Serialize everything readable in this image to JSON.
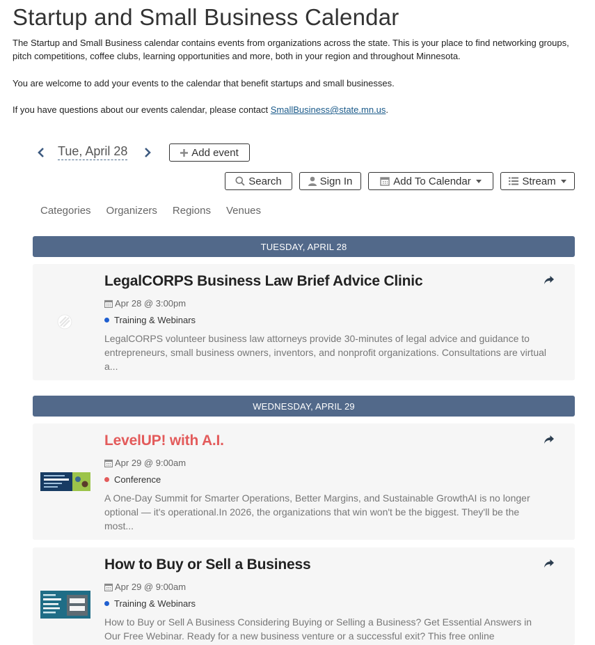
{
  "page": {
    "title": "Startup and Small Business Calendar",
    "intro_1": "The Startup and Small Business calendar contains events from organizations across the state. This is your place to find networking groups, pitch competitions, coffee clubs, learning opportunities and more, both in your region and throughout Minnesota.",
    "intro_2": "You are welcome to add your events to the calendar that benefit startups and small businesses.",
    "intro_3_prefix": "If you have questions about our events calendar, please contact ",
    "intro_3_link": "SmallBusiness@state.mn.us",
    "intro_3_suffix": "."
  },
  "toolbar": {
    "current_date": "Tue, April 28",
    "add_event_label": "Add event",
    "search_label": "Search",
    "sign_in_label": "Sign In",
    "add_to_calendar_label": "Add To Calendar",
    "stream_label": "Stream"
  },
  "filters": [
    "Categories",
    "Organizers",
    "Regions",
    "Venues"
  ],
  "days": [
    {
      "header": "TUESDAY, APRIL 28",
      "events": [
        {
          "title": "LegalCORPS Business Law Brief Advice Clinic",
          "date": "Apr 28 @ 3:00pm",
          "category": "Training & Webinars",
          "category_color": "#1f5fd0",
          "title_color": "#1f5fd0",
          "description": "LegalCORPS volunteer business law attorneys provide 30-minutes of legal advice and guidance to entrepreneurs, small business owners, inventors, and nonprofit organizations. Consultations are virtual a..."
        }
      ]
    },
    {
      "header": "WEDNESDAY, APRIL 29",
      "events": [
        {
          "title": "LevelUP! with A.I.",
          "date": "Apr 29 @ 9:00am",
          "category": "Conference",
          "category_color": "#e35b5b",
          "title_color": "#e35b5b",
          "description": "A One-Day Summit for Smarter Operations, Better Margins, and Sustainable GrowthAI is no longer optional — it's operational.In 2026, the organizations that win won't be the biggest. They'll be the most..."
        },
        {
          "title": "How to Buy or Sell a Business",
          "date": "Apr 29 @ 9:00am",
          "category": "Training & Webinars",
          "category_color": "#1f5fd0",
          "title_color": "#1f5fd0",
          "description": "How to Buy or Sell A Business Considering Buying or Selling a Business? Get Essential Answers in Our Free Webinar. Ready for a new business venture or a successful exit? This free online"
        }
      ]
    }
  ]
}
